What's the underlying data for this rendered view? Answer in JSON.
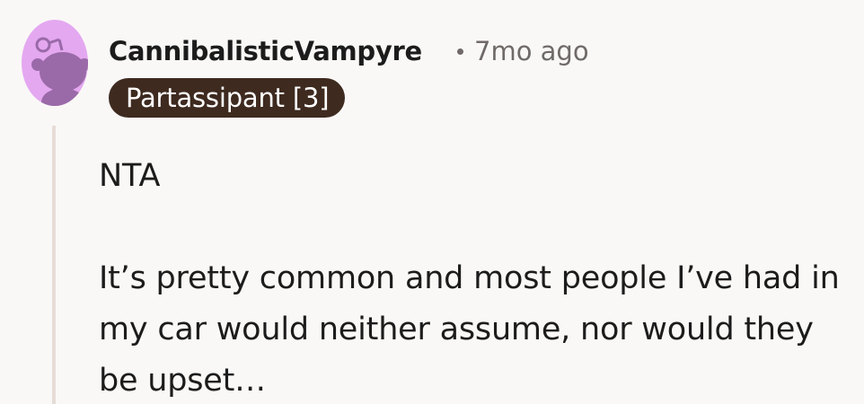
{
  "comment": {
    "author": "CannibalisticVampyre",
    "age": "7mo ago",
    "flair": "Partassipant [3]",
    "paragraphs": [
      "NTA",
      "It’s pretty common and most people I’ve had in my car would neither assume, nor would they be upset…"
    ]
  },
  "colors": {
    "avatar_bg": "#e4a8f0",
    "avatar_snoo": "#9a6aa8",
    "flair_bg": "#3e2a1f",
    "flair_text": "#ffffff",
    "thread_line": "#e6dcd6",
    "page_bg": "#faf8f7"
  },
  "icons": {
    "avatar": "snoo-avatar-icon"
  }
}
